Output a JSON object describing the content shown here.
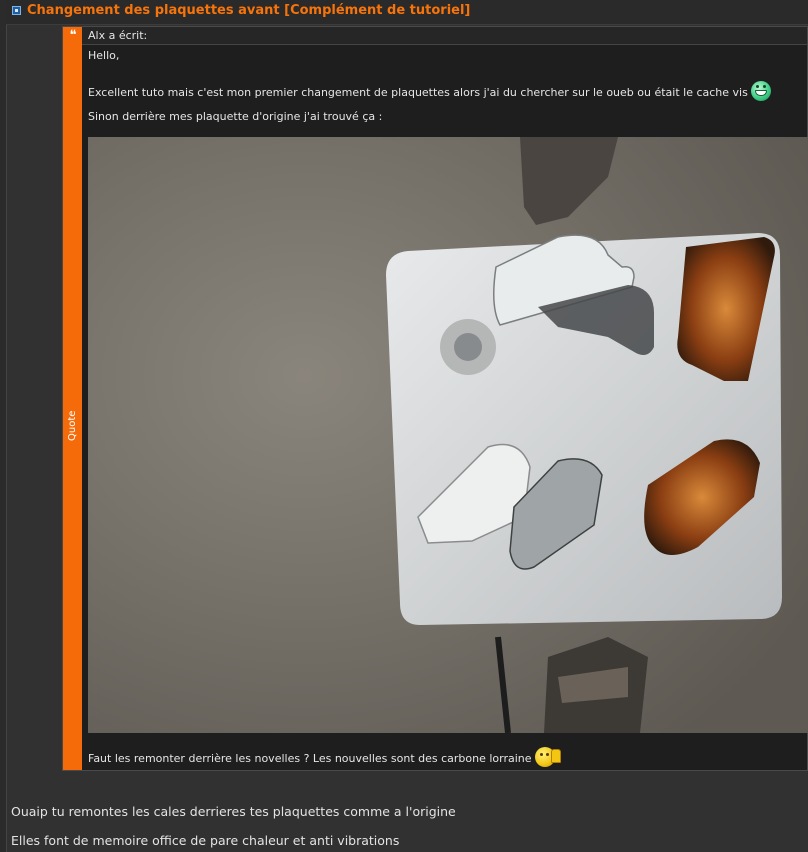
{
  "post": {
    "title": "Changement des plaquettes avant [Complément de tutoriel]"
  },
  "quote": {
    "vertical_label": "Quote",
    "author_line": "Alx a écrit:",
    "lines": {
      "greeting": "Hello,",
      "line1": "Excellent tuto mais c'est mon premier changement de plaquettes alors j'ai du chercher sur le oueb ou était le cache vis",
      "line2": "Sinon derrière mes plaquette d'origine j'ai trouvé ça :",
      "line3": "Faut les remonter derrière les novelles ? Les nouvelles sont des carbone lorraine"
    },
    "smileys": {
      "line1": "grin-smiley-icon",
      "line3": "thumbs-up-smiley-icon"
    }
  },
  "reply": {
    "line1": "Ouaip tu remontes les cales derrieres tes plaquettes comme a l'origine",
    "line2": "Elles font de memoire office de pare chaleur et anti vibrations"
  },
  "colors": {
    "title_orange": "#f7740a",
    "quote_bar_orange": "#f56b0a",
    "background": "#2b2b2b"
  }
}
